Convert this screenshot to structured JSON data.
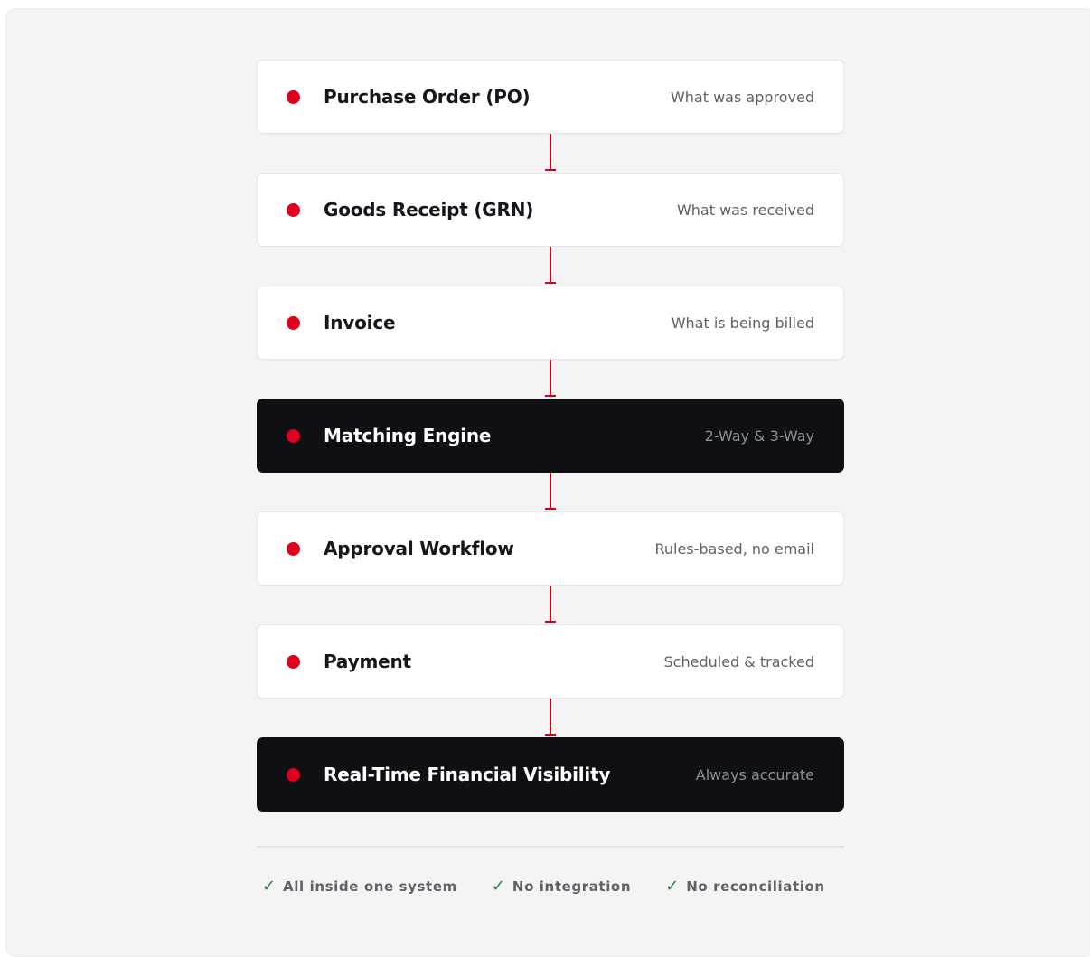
{
  "flow": {
    "steps": [
      {
        "title": "Purchase Order (PO)",
        "subtitle": "What was approved",
        "style": "light"
      },
      {
        "title": "Goods Receipt (GRN)",
        "subtitle": "What was received",
        "style": "light"
      },
      {
        "title": "Invoice",
        "subtitle": "What is being billed",
        "style": "light"
      },
      {
        "title": "Matching Engine",
        "subtitle": "2-Way & 3-Way",
        "style": "dark"
      },
      {
        "title": "Approval Workflow",
        "subtitle": "Rules-based, no email",
        "style": "light"
      },
      {
        "title": "Payment",
        "subtitle": "Scheduled & tracked",
        "style": "light"
      },
      {
        "title": "Real-Time Financial Visibility",
        "subtitle": "Always accurate",
        "style": "dark"
      }
    ]
  },
  "checks": {
    "mark": "✓",
    "items": [
      "All inside one system",
      "No integration",
      "No reconciliation"
    ]
  },
  "colors": {
    "accent": "#e0001b",
    "dark_card": "#0e1014",
    "check": "#2f7d45",
    "panel": "#f4f4f4"
  },
  "icons": {
    "step_bullet": "red-dot-icon",
    "connector": "arrow-down-icon",
    "check": "check-icon"
  }
}
